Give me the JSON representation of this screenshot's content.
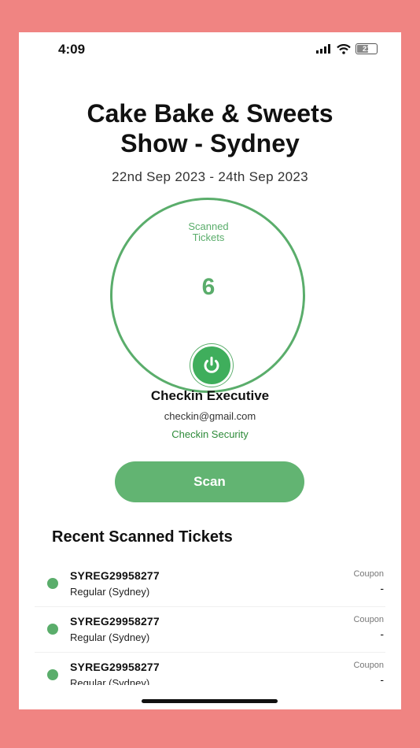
{
  "status_bar": {
    "time": "4:09",
    "battery_level": "21"
  },
  "event": {
    "title_line1": "Cake Bake & Sweets",
    "title_line2": "Show - Sydney",
    "dates": "22nd Sep 2023 - 24th Sep 2023"
  },
  "scanned": {
    "label_line1": "Scanned",
    "label_line2": "Tickets",
    "count": "6"
  },
  "user": {
    "name": "Checkin Executive",
    "email": "checkin@gmail.com",
    "role": "Checkin Security"
  },
  "scan_button_label": "Scan",
  "recent": {
    "title": "Recent Scanned Tickets",
    "items": [
      {
        "code": "SYREG29958277",
        "type": "Regular (Sydney)",
        "coupon_label": "Coupon",
        "coupon_value": "-"
      },
      {
        "code": "SYREG29958277",
        "type": "Regular (Sydney)",
        "coupon_label": "Coupon",
        "coupon_value": "-"
      },
      {
        "code": "SYREG29958277",
        "type": "Regular (Sydney)",
        "coupon_label": "Coupon",
        "coupon_value": "-"
      }
    ]
  },
  "colors": {
    "accent": "#5aad6b",
    "background": "#f08482"
  }
}
